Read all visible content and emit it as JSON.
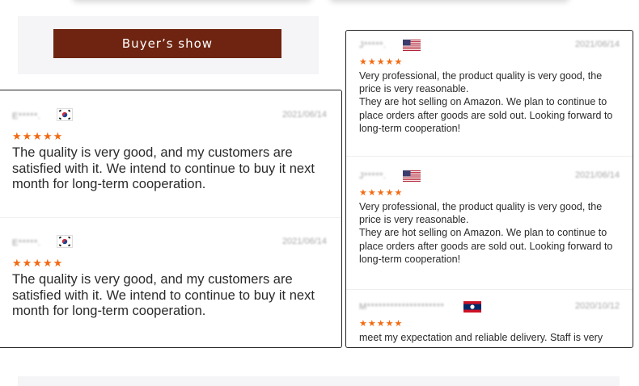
{
  "banner": {
    "title": "Buyer’s show"
  },
  "colors": {
    "banner_bg": "#6e2410",
    "star": "#f26a12",
    "panel_border": "#222222"
  },
  "left_reviews": [
    {
      "reviewer": "E*****.",
      "flag": "south-korea-flag-icon",
      "date": "2021/06/14",
      "rating": 5,
      "stars": "★★★★★",
      "text": "The quality is very good, and my customers are satisfied with it. We intend to continue to buy it next month for long-term cooperation."
    },
    {
      "reviewer": "E*****.",
      "flag": "south-korea-flag-icon",
      "date": "2021/06/14",
      "rating": 5,
      "stars": "★★★★★",
      "text": "The quality is very good, and my customers are satisfied with it. We intend to continue to buy it next month for long-term cooperation."
    }
  ],
  "right_reviews": [
    {
      "reviewer": "J*****.",
      "flag": "usa-flag-icon",
      "date": "2021/06/14",
      "rating": 5,
      "stars": "★★★★★",
      "text_1": "Very professional, the product quality is very good, the price is very reasonable.",
      "text_2": "They are hot selling on Amazon. We plan to continue to place orders after goods are sold out. Looking forward to long-term cooperation!"
    },
    {
      "reviewer": "J*****.",
      "flag": "usa-flag-icon",
      "date": "2021/06/14",
      "rating": 5,
      "stars": "★★★★★",
      "text_1": "Very professional, the product quality is very good, the price is very reasonable.",
      "text_2": "They are hot selling on Amazon. We plan to continue to place orders after goods are sold out. Looking forward to long-term cooperation!"
    },
    {
      "reviewer": "M********************",
      "flag": "laos-flag-icon",
      "date": "2020/10/12",
      "rating": 5,
      "stars": "★★★★★",
      "text_1": "meet my expectation and reliable delivery. Staff is very"
    }
  ]
}
